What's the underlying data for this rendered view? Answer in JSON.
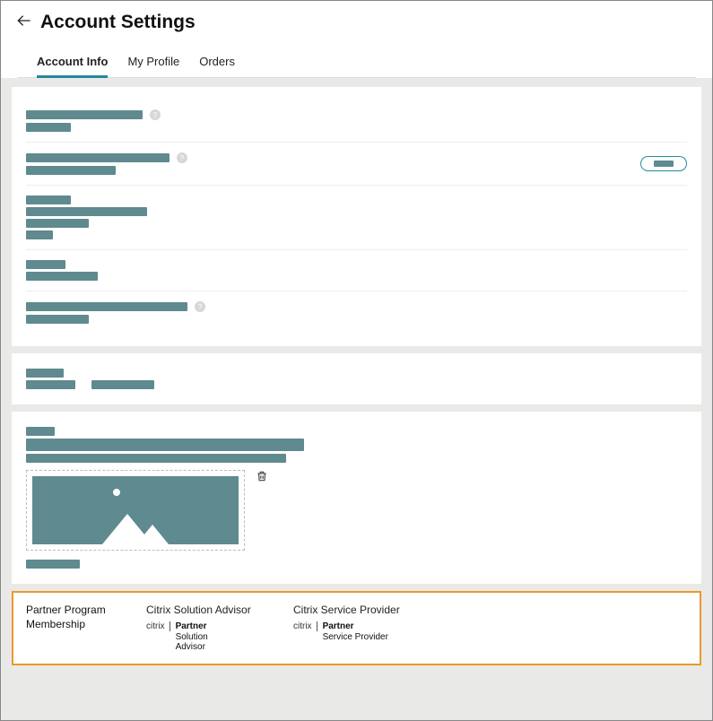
{
  "header": {
    "title": "Account Settings"
  },
  "tabs": [
    {
      "label": "Account Info",
      "active": true
    },
    {
      "label": "My Profile",
      "active": false
    },
    {
      "label": "Orders",
      "active": false
    }
  ],
  "partner_section": {
    "heading": "Partner Program Membership",
    "programs": [
      {
        "title": "Citrix Solution Advisor",
        "brand": "citrix",
        "line1": "Partner",
        "line2": "Solution",
        "line3": "Advisor"
      },
      {
        "title": "Citrix Service Provider",
        "brand": "citrix",
        "line1": "Partner",
        "line2": "Service Provider",
        "line3": ""
      }
    ]
  }
}
